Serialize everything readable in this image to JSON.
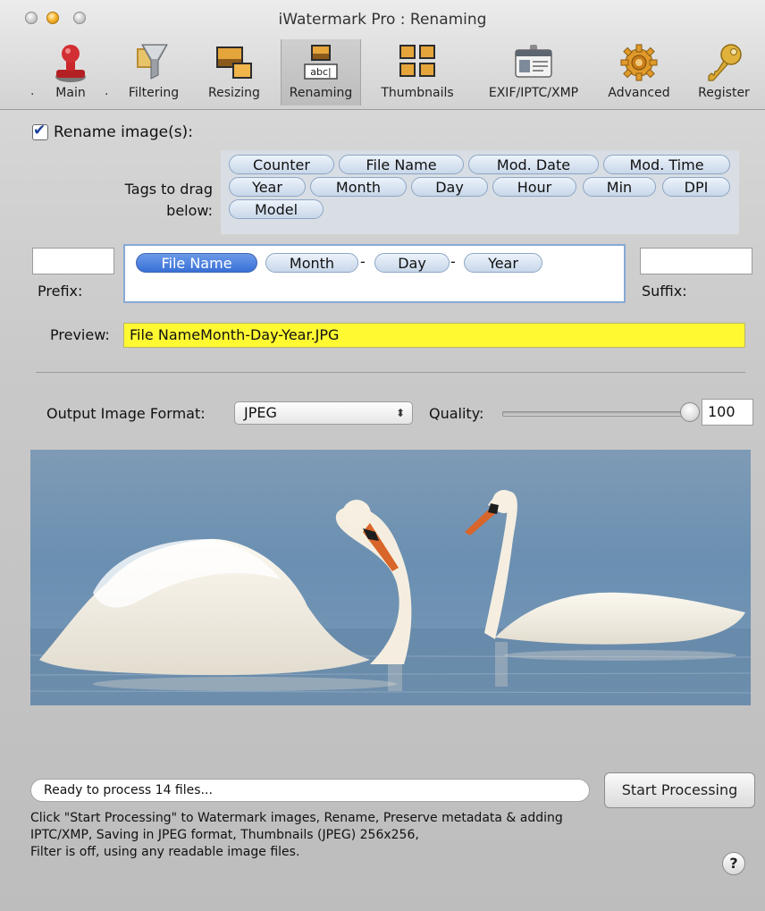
{
  "window": {
    "title": "iWatermark Pro : Renaming"
  },
  "toolbar": {
    "items": [
      {
        "label": "Main",
        "icon": "stamp-icon"
      },
      {
        "label": "Filtering",
        "icon": "funnel-icon"
      },
      {
        "label": "Resizing",
        "icon": "resize-icon"
      },
      {
        "label": "Renaming",
        "icon": "rename-icon",
        "selected": true
      },
      {
        "label": "Thumbnails",
        "icon": "thumbnails-icon"
      },
      {
        "label": "EXIF/IPTC/XMP",
        "icon": "id-card-icon"
      },
      {
        "label": "Advanced",
        "icon": "gear-icon"
      },
      {
        "label": "Register",
        "icon": "key-icon"
      }
    ],
    "dot": "."
  },
  "rename": {
    "checkbox_label": "Rename image(s):",
    "checked": true,
    "tags_label_line1": "Tags to drag",
    "tags_label_line2": "below:",
    "tags": [
      "Counter",
      "File Name",
      "Mod. Date",
      "Mod. Time",
      "Year",
      "Month",
      "Day",
      "Hour",
      "Min",
      "DPI",
      "Model"
    ],
    "pattern": {
      "tags": [
        "File Name",
        "Month",
        "Day",
        "Year"
      ],
      "separator": "-"
    },
    "prefix_label": "Prefix:",
    "suffix_label": "Suffix:",
    "prefix_value": "",
    "suffix_value": "",
    "preview_label": "Preview:",
    "preview_value": "File NameMonth-Day-Year.JPG"
  },
  "output": {
    "format_label": "Output Image Format:",
    "format_value": "JPEG",
    "quality_label": "Quality:",
    "quality_value": "100",
    "quality_fraction": 1.0
  },
  "status": {
    "text": "Ready to process 14 files...",
    "start_button": "Start Processing",
    "info_line1": "Click \"Start Processing\" to Watermark images, Rename, Preserve metadata & adding",
    "info_line2": "IPTC/XMP, Saving in JPEG format, Thumbnails (JPEG) 256x256,",
    "info_line3": "Filter is off, using any readable image files.",
    "help": "?"
  },
  "colors": {
    "preview_bg": "#fff932",
    "selected_tag": "#4a7fde",
    "tag_bg": "#d5e1ef"
  }
}
